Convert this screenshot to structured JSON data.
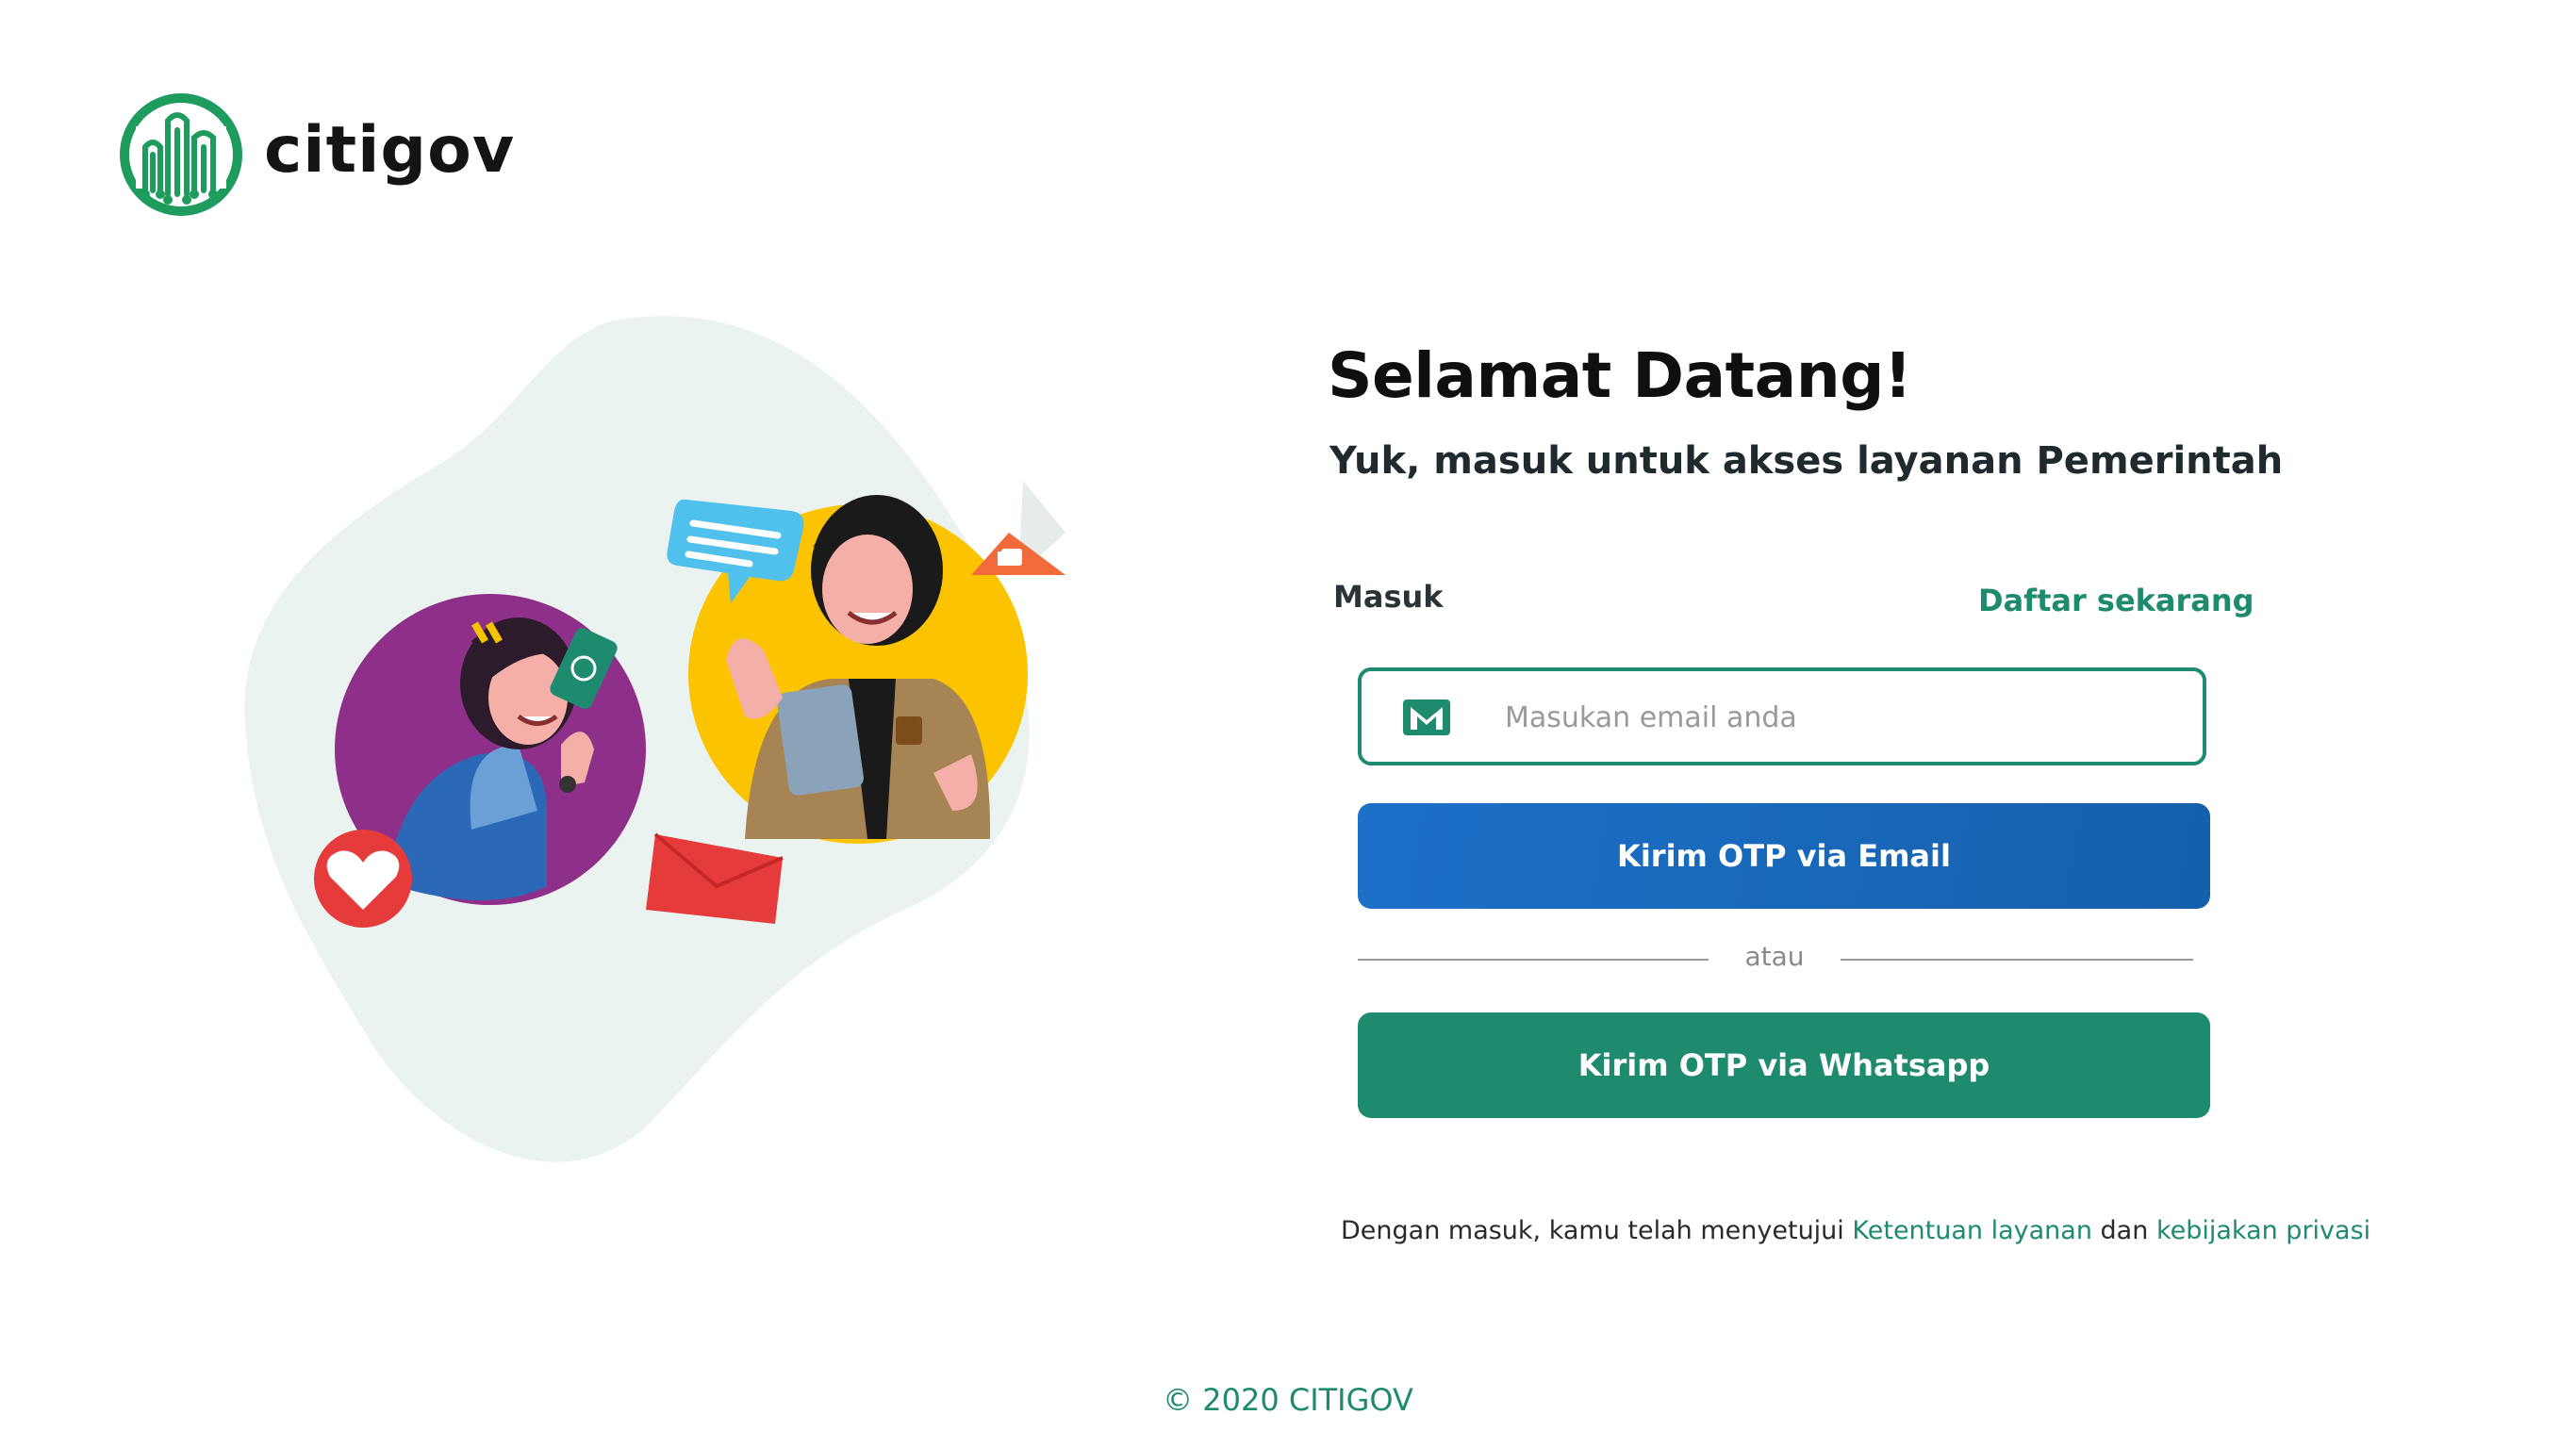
{
  "brand": {
    "name": "citigov",
    "logo_icon": "city-buildings-logo-icon",
    "color": "#1e9c5e"
  },
  "illustration": {
    "icons": [
      "woman-with-phone-icon",
      "man-with-tablet-icon",
      "chat-bubble-icon",
      "thumbs-up-icon",
      "heart-icon",
      "envelope-icon"
    ]
  },
  "hero": {
    "title": "Selamat Datang!",
    "subtitle": "Yuk, masuk untuk akses layanan Pemerintah"
  },
  "tabs": {
    "login_label": "Masuk",
    "register_link": "Daftar sekarang"
  },
  "form": {
    "email_icon": "gmail-icon",
    "email_placeholder": "Masukan email anda",
    "email_value": "",
    "btn_email": "Kirim OTP via Email",
    "divider": "atau",
    "btn_whatsapp": "Kirim OTP via Whatsapp"
  },
  "terms": {
    "prefix": "Dengan masuk, kamu telah menyetujui",
    "link_terms": "Ketentuan layanan",
    "conj": "dan",
    "link_privacy": "kebijakan privasi"
  },
  "footer": {
    "copyright": "© 2020 CITIGOV"
  },
  "colors": {
    "primary_green": "#1e8a6e",
    "primary_blue": "#1a6cc0",
    "blob": "#ebf3f1"
  }
}
